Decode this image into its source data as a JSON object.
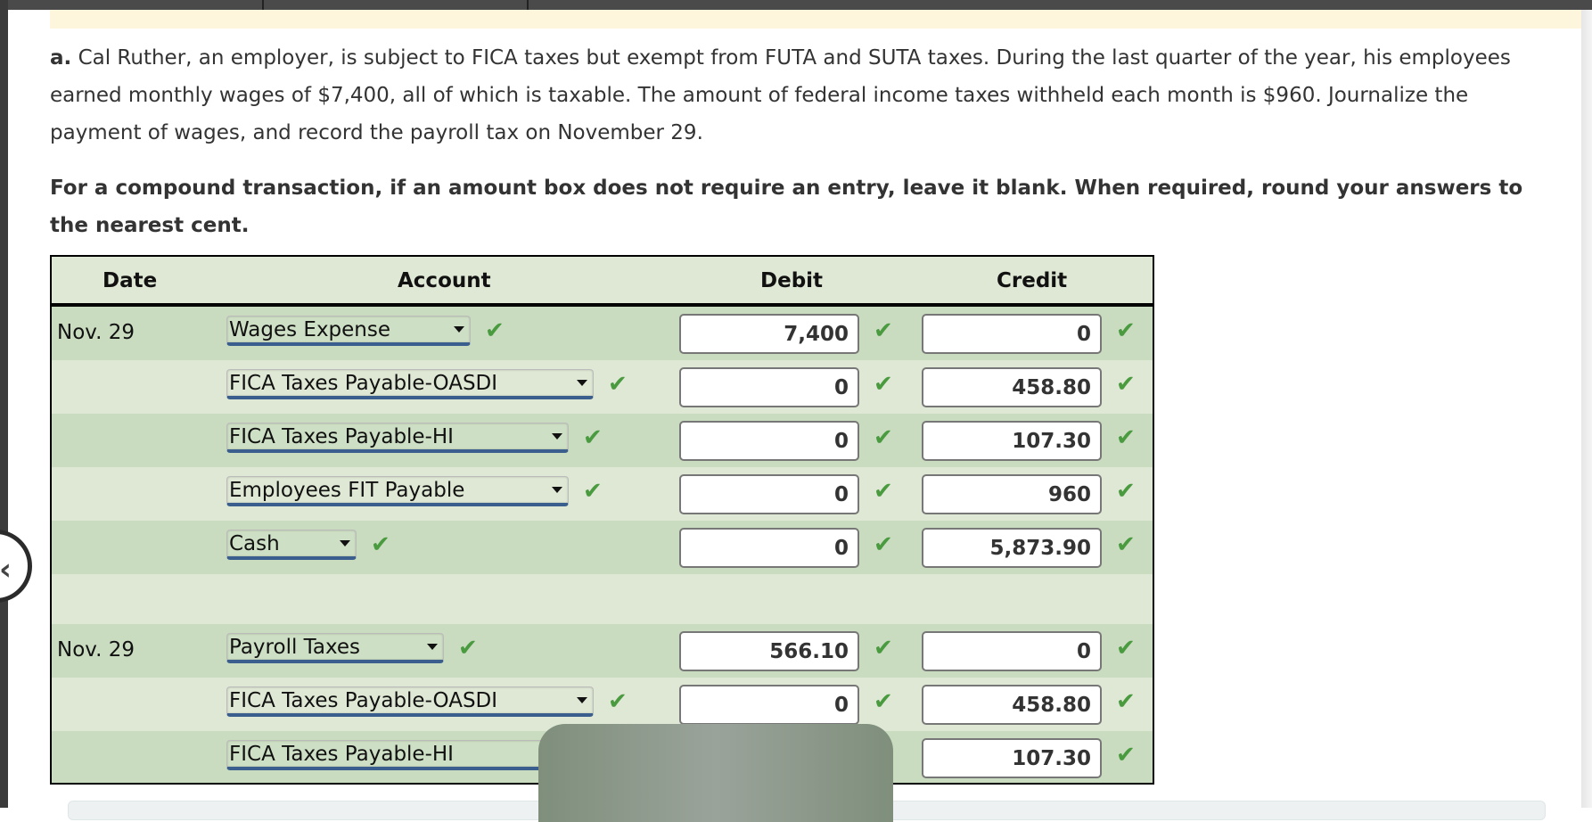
{
  "problem": {
    "label": "a.",
    "text": " Cal Ruther, an employer, is subject to FICA taxes but exempt from FUTA and SUTA taxes. During the last quarter of the year, his employees earned monthly wages of $7,400, all of which is taxable. The amount of federal income taxes withheld each month is $960. Journalize the payment of wages, and record the payroll tax on November 29.",
    "instructions": "For a compound transaction, if an amount box does not require an entry, leave it blank. When required, round your answers to the nearest cent."
  },
  "table": {
    "headers": {
      "date": "Date",
      "account": "Account",
      "debit": "Debit",
      "credit": "Credit"
    },
    "rows": [
      {
        "date": "Nov. 29",
        "account": "Wages Expense",
        "debit": "7,400",
        "credit": "0",
        "account_correct": true,
        "debit_correct": true,
        "credit_correct": true
      },
      {
        "date": "",
        "account": "FICA Taxes Payable-OASDI",
        "debit": "0",
        "credit": "458.80",
        "account_correct": true,
        "debit_correct": true,
        "credit_correct": true
      },
      {
        "date": "",
        "account": "FICA Taxes Payable-HI",
        "debit": "0",
        "credit": "107.30",
        "account_correct": true,
        "debit_correct": true,
        "credit_correct": true
      },
      {
        "date": "",
        "account": "Employees FIT Payable",
        "debit": "0",
        "credit": "960",
        "account_correct": true,
        "debit_correct": true,
        "credit_correct": true
      },
      {
        "date": "",
        "account": "Cash",
        "debit": "0",
        "credit": "5,873.90",
        "account_correct": true,
        "debit_correct": true,
        "credit_correct": true
      },
      {
        "date": "Nov. 29",
        "account": "Payroll Taxes",
        "debit": "566.10",
        "credit": "0",
        "account_correct": true,
        "debit_correct": true,
        "credit_correct": true
      },
      {
        "date": "",
        "account": "FICA Taxes Payable-OASDI",
        "debit": "0",
        "credit": "458.80",
        "account_correct": true,
        "debit_correct": true,
        "credit_correct": true
      },
      {
        "date": "",
        "account": "FICA Taxes Payable-HI",
        "debit": "",
        "credit": "107.30",
        "account_correct": true,
        "debit_correct": true,
        "credit_correct": true
      }
    ]
  },
  "icons": {
    "check": "✔",
    "back": "‹"
  },
  "colors": {
    "check_green": "#4a9a40",
    "row_dark": "#c9dcc0",
    "row_light": "#dfe8d4",
    "select_underline": "#3a5f8f",
    "banner_yellow": "#fdf5dc"
  }
}
